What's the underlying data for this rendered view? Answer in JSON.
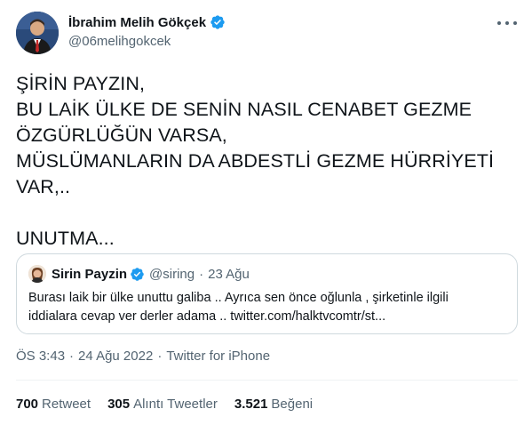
{
  "author": {
    "display_name": "İbrahim Melih Gökçek",
    "handle": "@06melihgokcek",
    "avatar_icon": "person-avatar-icon",
    "verified_icon": "verified-badge-icon"
  },
  "tweet": {
    "lines": [
      "ŞİRİN PAYZIN,",
      "BU LAİK ÜLKE DE SENİN NASIL CENABET GEZME",
      "ÖZGÜRLÜĞÜN VARSA,",
      "MÜSLÜMANLARIN DA ABDESTLİ GEZME HÜRRİYETİ",
      "VAR,..",
      "",
      "UNUTMA..."
    ]
  },
  "quote": {
    "display_name": "Sirin Payzin",
    "handle": "@siring",
    "dot": "·",
    "date": "23 Ağu",
    "lines": [
      "Burası laik bir ülke unuttu galiba .. Ayrıca sen önce oğlunla , şirketinle ilgili",
      "iddialara cevap ver derler adama .. twitter.com/halktvcomtr/st..."
    ]
  },
  "meta": {
    "time": "ÖS 3:43",
    "sep": "·",
    "date": "24 Ağu 2022",
    "source": "Twitter for iPhone"
  },
  "stats": {
    "retweets_count": "700",
    "retweets_label": "Retweet",
    "quotes_count": "305",
    "quotes_label": "Alıntı Tweetler",
    "likes_count": "3.521",
    "likes_label": "Beğeni"
  },
  "colors": {
    "verified_blue": "#1d9bf0",
    "text_primary": "#0f1419",
    "text_secondary": "#536471",
    "border": "#cfd9de"
  }
}
